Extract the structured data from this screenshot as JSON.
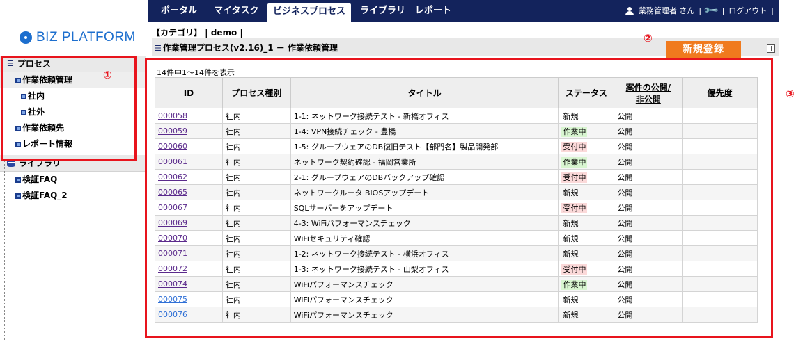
{
  "nav": {
    "items": [
      "ポータル",
      "マイタスク",
      "ビジネスプロセス",
      "ライブラリ",
      "レポート"
    ],
    "active_index": 2,
    "user_label": "業務管理者 さん",
    "logout_label": "ログアウト"
  },
  "logo_text": "BIZ PLATFORM",
  "breadcrumb": "【カテゴリ】 | demo |",
  "process_title": "作業管理プロセス(v2.16)_1 － 作業依頼管理",
  "new_button_label": "新規登録",
  "sidebar": {
    "process_header": "プロセス",
    "process_items": [
      "作業依頼管理",
      "社内",
      "社外",
      "作業依頼先",
      "レポート情報"
    ],
    "library_header": "ライブラリ",
    "library_items": [
      "検証FAQ",
      "検証FAQ_2"
    ]
  },
  "annotations": [
    "①",
    "②",
    "③"
  ],
  "record_count": "14件中1～14件を表示",
  "table": {
    "headers": [
      "ID",
      "プロセス種別",
      "タイトル",
      "ステータス",
      "案件の公開/\n非公開",
      "優先度"
    ],
    "rows": [
      {
        "id": "000058",
        "type": "社内",
        "title": "1-1: ネットワーク接続テスト - 新橋オフィス",
        "status": "新規",
        "visibility": "公開",
        "priority": ""
      },
      {
        "id": "000059",
        "type": "社内",
        "title": "1-4: VPN接続チェック - 豊橋",
        "status": "作業中",
        "visibility": "公開",
        "priority": ""
      },
      {
        "id": "000060",
        "type": "社内",
        "title": "1-5: グループウェアのDB復旧テスト【部門名】製品開発部",
        "status": "受付中",
        "visibility": "公開",
        "priority": ""
      },
      {
        "id": "000061",
        "type": "社内",
        "title": "ネットワーク契約確認 - 福岡営業所",
        "status": "作業中",
        "visibility": "公開",
        "priority": ""
      },
      {
        "id": "000062",
        "type": "社内",
        "title": "2-1: グループウェアのDBバックアップ確認",
        "status": "受付中",
        "visibility": "公開",
        "priority": ""
      },
      {
        "id": "000065",
        "type": "社内",
        "title": "ネットワークルータ BIOSアップデート",
        "status": "新規",
        "visibility": "公開",
        "priority": ""
      },
      {
        "id": "000067",
        "type": "社内",
        "title": "SQLサーバーをアップデート",
        "status": "受付中",
        "visibility": "公開",
        "priority": ""
      },
      {
        "id": "000069",
        "type": "社内",
        "title": "4-3: WiFiパフォーマンスチェック",
        "status": "新規",
        "visibility": "公開",
        "priority": ""
      },
      {
        "id": "000070",
        "type": "社内",
        "title": "WiFiセキュリティ確認",
        "status": "新規",
        "visibility": "公開",
        "priority": ""
      },
      {
        "id": "000071",
        "type": "社内",
        "title": "1-2: ネットワーク接続テスト - 横浜オフィス",
        "status": "新規",
        "visibility": "公開",
        "priority": ""
      },
      {
        "id": "000072",
        "type": "社内",
        "title": "1-3: ネットワーク接続テスト - 山梨オフィス",
        "status": "受付中",
        "visibility": "公開",
        "priority": ""
      },
      {
        "id": "000074",
        "type": "社内",
        "title": "WiFiパフォーマンスチェック",
        "status": "作業中",
        "visibility": "公開",
        "priority": ""
      },
      {
        "id": "000075",
        "type": "社内",
        "title": "WiFiパフォーマンスチェック",
        "status": "新規",
        "visibility": "公開",
        "priority": ""
      },
      {
        "id": "000076",
        "type": "社内",
        "title": "WiFiパフォーマンスチェック",
        "status": "新規",
        "visibility": "公開",
        "priority": ""
      }
    ]
  },
  "colors": {
    "nav_bg": "#13235c",
    "new_button": "#f07a1e",
    "annotation": "#e8141d",
    "status_in_progress": "#d8f5d0",
    "status_accepted": "#fbd9d9"
  }
}
